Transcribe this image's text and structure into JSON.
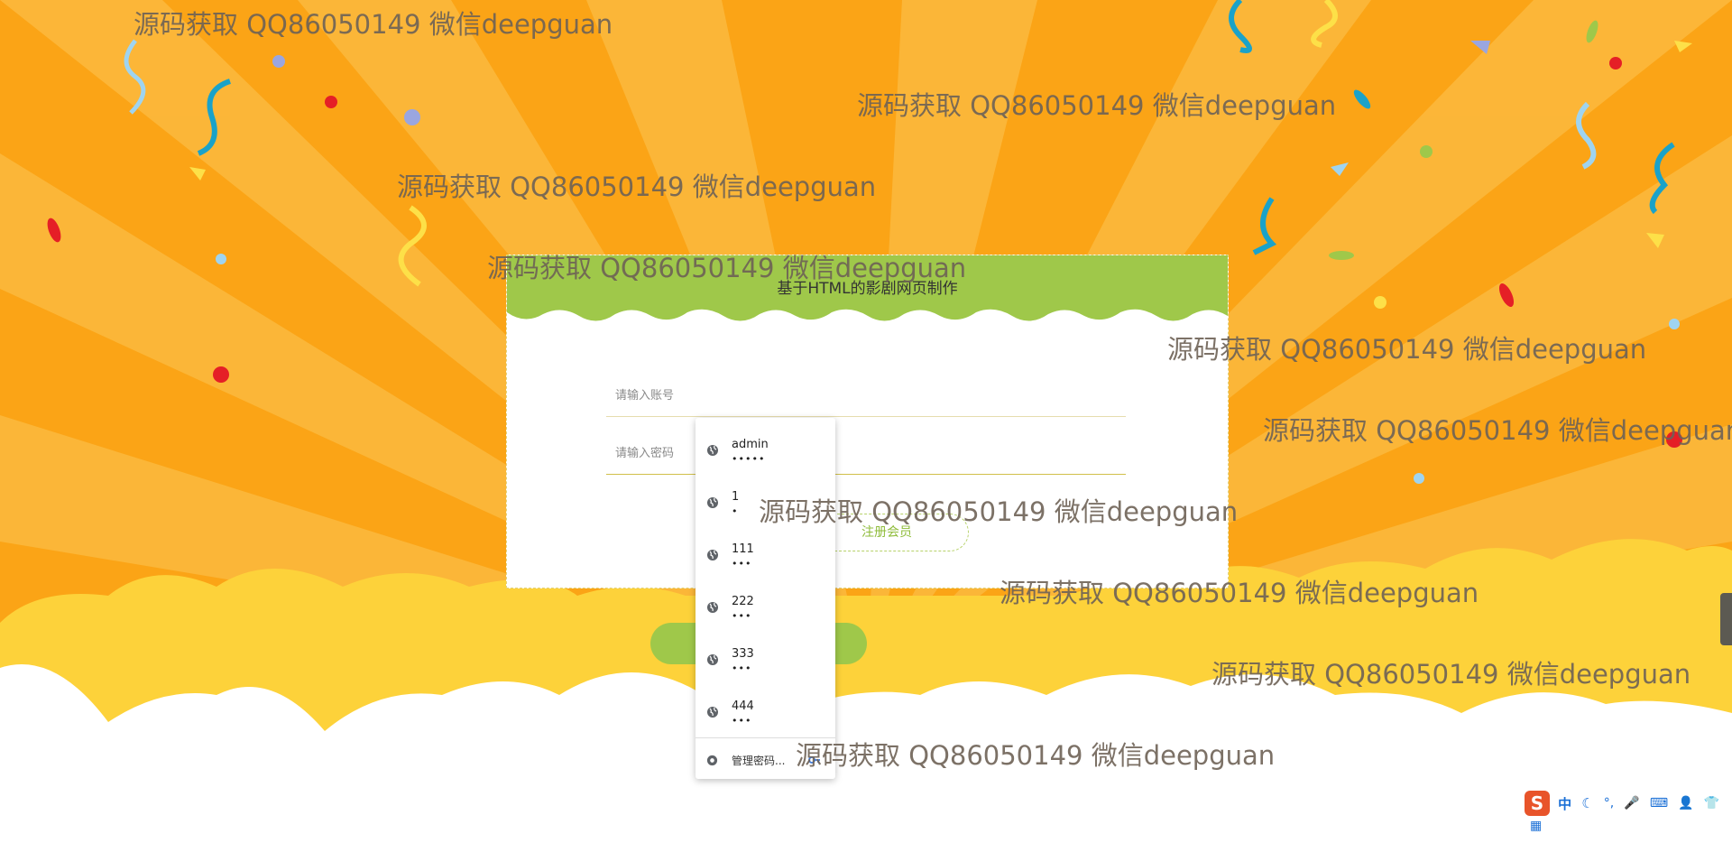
{
  "card": {
    "title": "基于HTML的影剧网页制作"
  },
  "account": {
    "placeholder": "请输入账号"
  },
  "password": {
    "placeholder": "请输入密码"
  },
  "register_label": "注册会员",
  "autofill": {
    "items": [
      {
        "username": "admin",
        "password": "•••••"
      },
      {
        "username": "1",
        "password": "•"
      },
      {
        "username": "111",
        "password": "•••"
      },
      {
        "username": "222",
        "password": "•••"
      },
      {
        "username": "333",
        "password": "•••"
      },
      {
        "username": "444",
        "password": "•••"
      }
    ],
    "manage_label": "管理密码..."
  },
  "watermark": "源码获取 QQ86050149 微信deepguan",
  "ime": {
    "lang_label": "中"
  },
  "colors": {
    "background": "#fba416",
    "ray": "#fcb83c",
    "cloud_yellow": "#fdd23a",
    "cloud_white": "#ffffff",
    "header_green": "#9fc84a"
  },
  "icons": [
    "globe-icon",
    "chrome-icon",
    "key-icon",
    "sogou-ime-icon"
  ]
}
